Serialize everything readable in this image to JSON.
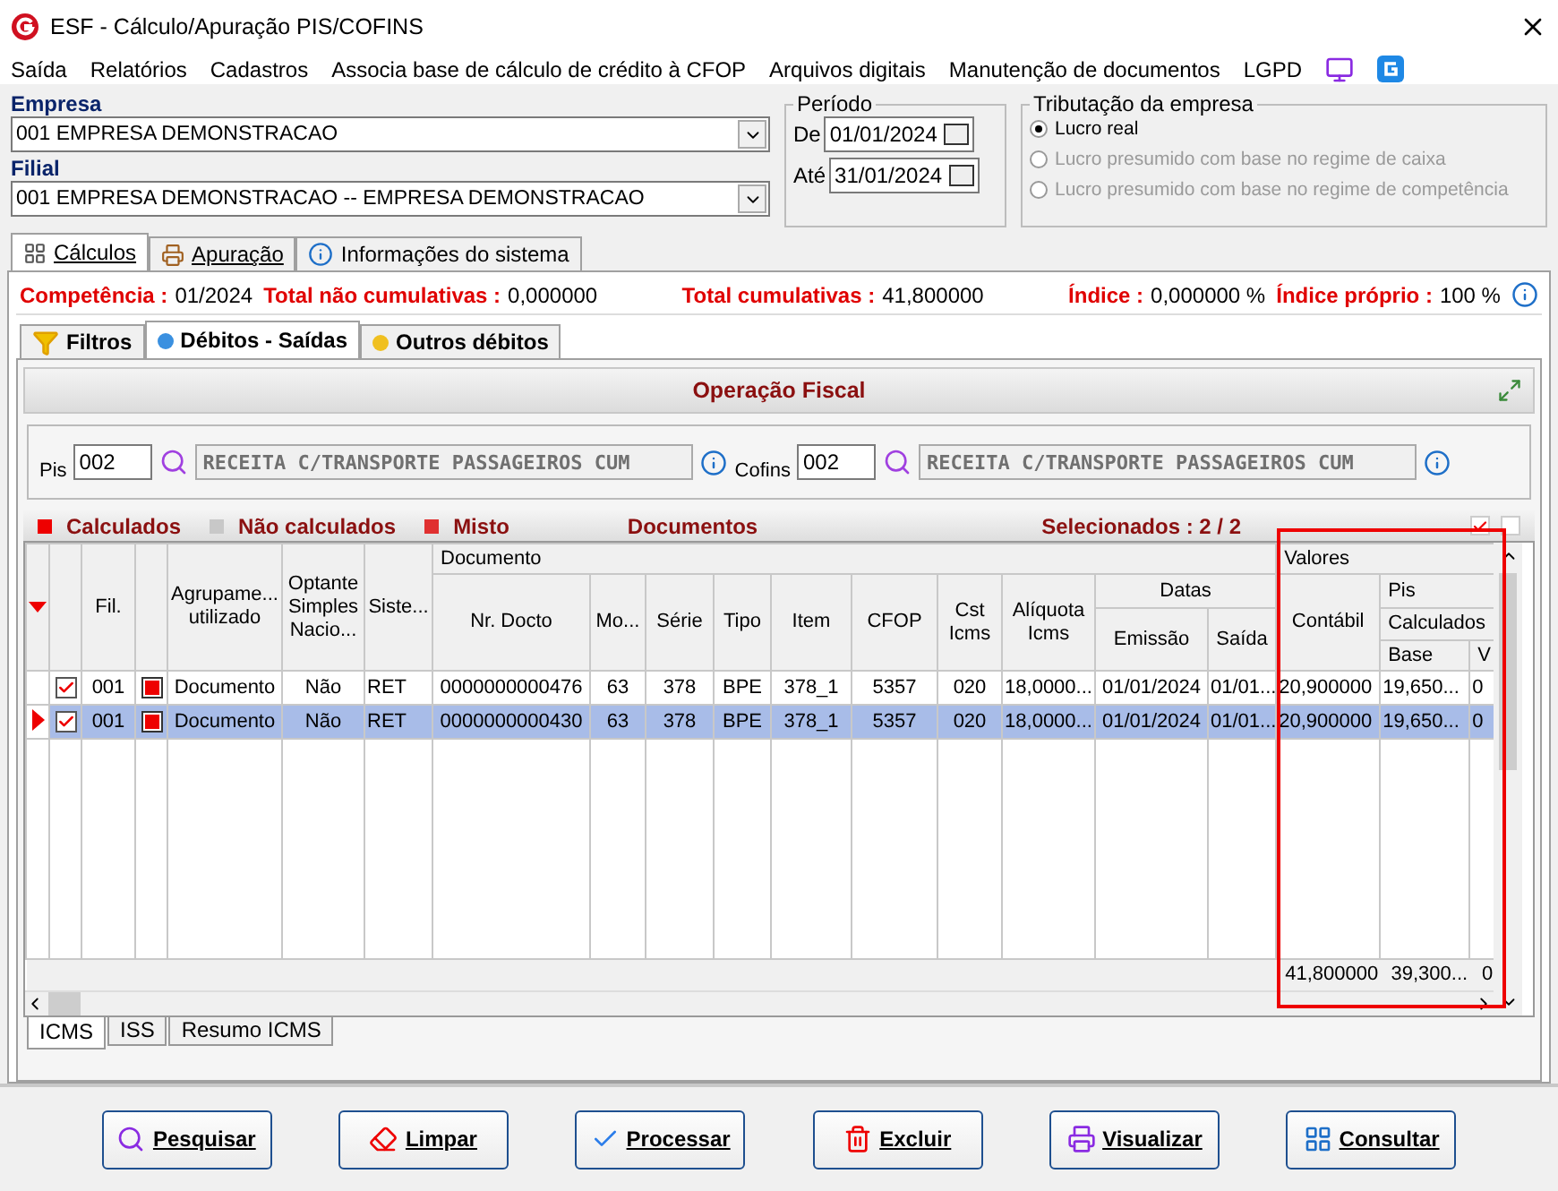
{
  "window": {
    "title": "ESF - Cálculo/Apuração PIS/COFINS"
  },
  "menu": [
    "Saída",
    "Relatórios",
    "Cadastros",
    "Associa base de cálculo de crédito à CFOP",
    "Arquivos digitais",
    "Manutenção de documentos",
    "LGPD"
  ],
  "empresa": {
    "label": "Empresa",
    "value": "001 EMPRESA DEMONSTRACAO"
  },
  "filial": {
    "label": "Filial",
    "value": "001 EMPRESA DEMONSTRACAO -- EMPRESA DEMONSTRACAO"
  },
  "periodo": {
    "title": "Período",
    "from_label": "De",
    "from": "01/01/2024",
    "to_label": "Até",
    "to": "31/01/2024"
  },
  "tributacao": {
    "title": "Tributação da empresa",
    "options": [
      {
        "label": "Lucro real",
        "selected": true,
        "disabled": false
      },
      {
        "label": "Lucro presumido com base no regime de caixa",
        "selected": false,
        "disabled": true
      },
      {
        "label": "Lucro presumido com base no regime de competência",
        "selected": false,
        "disabled": true
      }
    ]
  },
  "tabs": [
    {
      "label": "Cálculos",
      "selected": true
    },
    {
      "label": "Apuração",
      "selected": false
    },
    {
      "label": "Informações do sistema",
      "selected": false
    }
  ],
  "summary": [
    {
      "label": "Competência :",
      "value": "01/2024"
    },
    {
      "label": "Total não cumulativas :",
      "value": "0,000000"
    },
    {
      "label": "Total cumulativas :",
      "value": "41,800000"
    },
    {
      "label": "Índice :",
      "value": "0,000000 %"
    },
    {
      "label": "Índice próprio :",
      "value": "100 %"
    }
  ],
  "sub_tabs": [
    {
      "label": "Filtros",
      "selected": false
    },
    {
      "label": "Débitos - Saídas",
      "selected": true
    },
    {
      "label": "Outros débitos",
      "selected": false
    }
  ],
  "operacao": {
    "title": "Operação Fiscal",
    "pis_label": "Pis",
    "pis_code": "002",
    "pis_desc": "RECEITA C/TRANSPORTE PASSAGEIROS CUM",
    "cofins_label": "Cofins",
    "cofins_code": "002",
    "cofins_desc": "RECEITA C/TRANSPORTE PASSAGEIROS CUM"
  },
  "legend": [
    {
      "label": "Calculados",
      "color": "#ee0000"
    },
    {
      "label": "Não calculados",
      "color": "#c8c8c8"
    },
    {
      "label": "Misto",
      "color": "#e03030"
    }
  ],
  "documents_title": "Documentos",
  "selecionados": "Selecionados : 2 / 2",
  "header_checks": [
    {
      "checked": true
    },
    {
      "checked": false
    }
  ],
  "grid": {
    "documento": "Documento",
    "valores": "Valores",
    "datas": "Datas",
    "pis": "Pis",
    "calculados": "Calculados",
    "columns": [
      "Fil.",
      "Agrupame...\nutilizado",
      "Optante\nSimples\nNacio...",
      "Siste...",
      "Nr. Docto",
      "Mo...",
      "Série",
      "Tipo",
      "Item",
      "CFOP",
      "Cst\nIcms",
      "Alíquota\nIcms",
      "Emissão",
      "Saída",
      "Contábil",
      "Base",
      "V"
    ],
    "rows": [
      {
        "selected": false,
        "checked": true,
        "cells": [
          "001",
          "Documento",
          "Não",
          "RET",
          "0000000000476",
          "63",
          "378",
          "BPE",
          "378_1",
          "5357",
          "020",
          "18,0000...",
          "01/01/2024",
          "01/01...",
          "20,900000",
          "19,650...",
          "0"
        ]
      },
      {
        "selected": true,
        "checked": true,
        "cells": [
          "001",
          "Documento",
          "Não",
          "RET",
          "0000000000430",
          "63",
          "378",
          "BPE",
          "378_1",
          "5357",
          "020",
          "18,0000...",
          "01/01/2024",
          "01/01...",
          "20,900000",
          "19,650...",
          "0"
        ]
      }
    ],
    "totals": [
      "41,800000",
      "39,300...",
      "0"
    ]
  },
  "bottom_tabs": [
    {
      "label": "ICMS",
      "selected": true
    },
    {
      "label": "ISS",
      "selected": false
    },
    {
      "label": "Resumo ICMS",
      "selected": false
    }
  ],
  "buttons": [
    {
      "label": "Pesquisar",
      "kind": "search"
    },
    {
      "label": "Limpar",
      "kind": "clear"
    },
    {
      "label": "Processar",
      "kind": "process"
    },
    {
      "label": "Excluir",
      "kind": "delete"
    },
    {
      "label": "Visualizar",
      "kind": "print"
    },
    {
      "label": "Consultar",
      "kind": "query"
    }
  ]
}
